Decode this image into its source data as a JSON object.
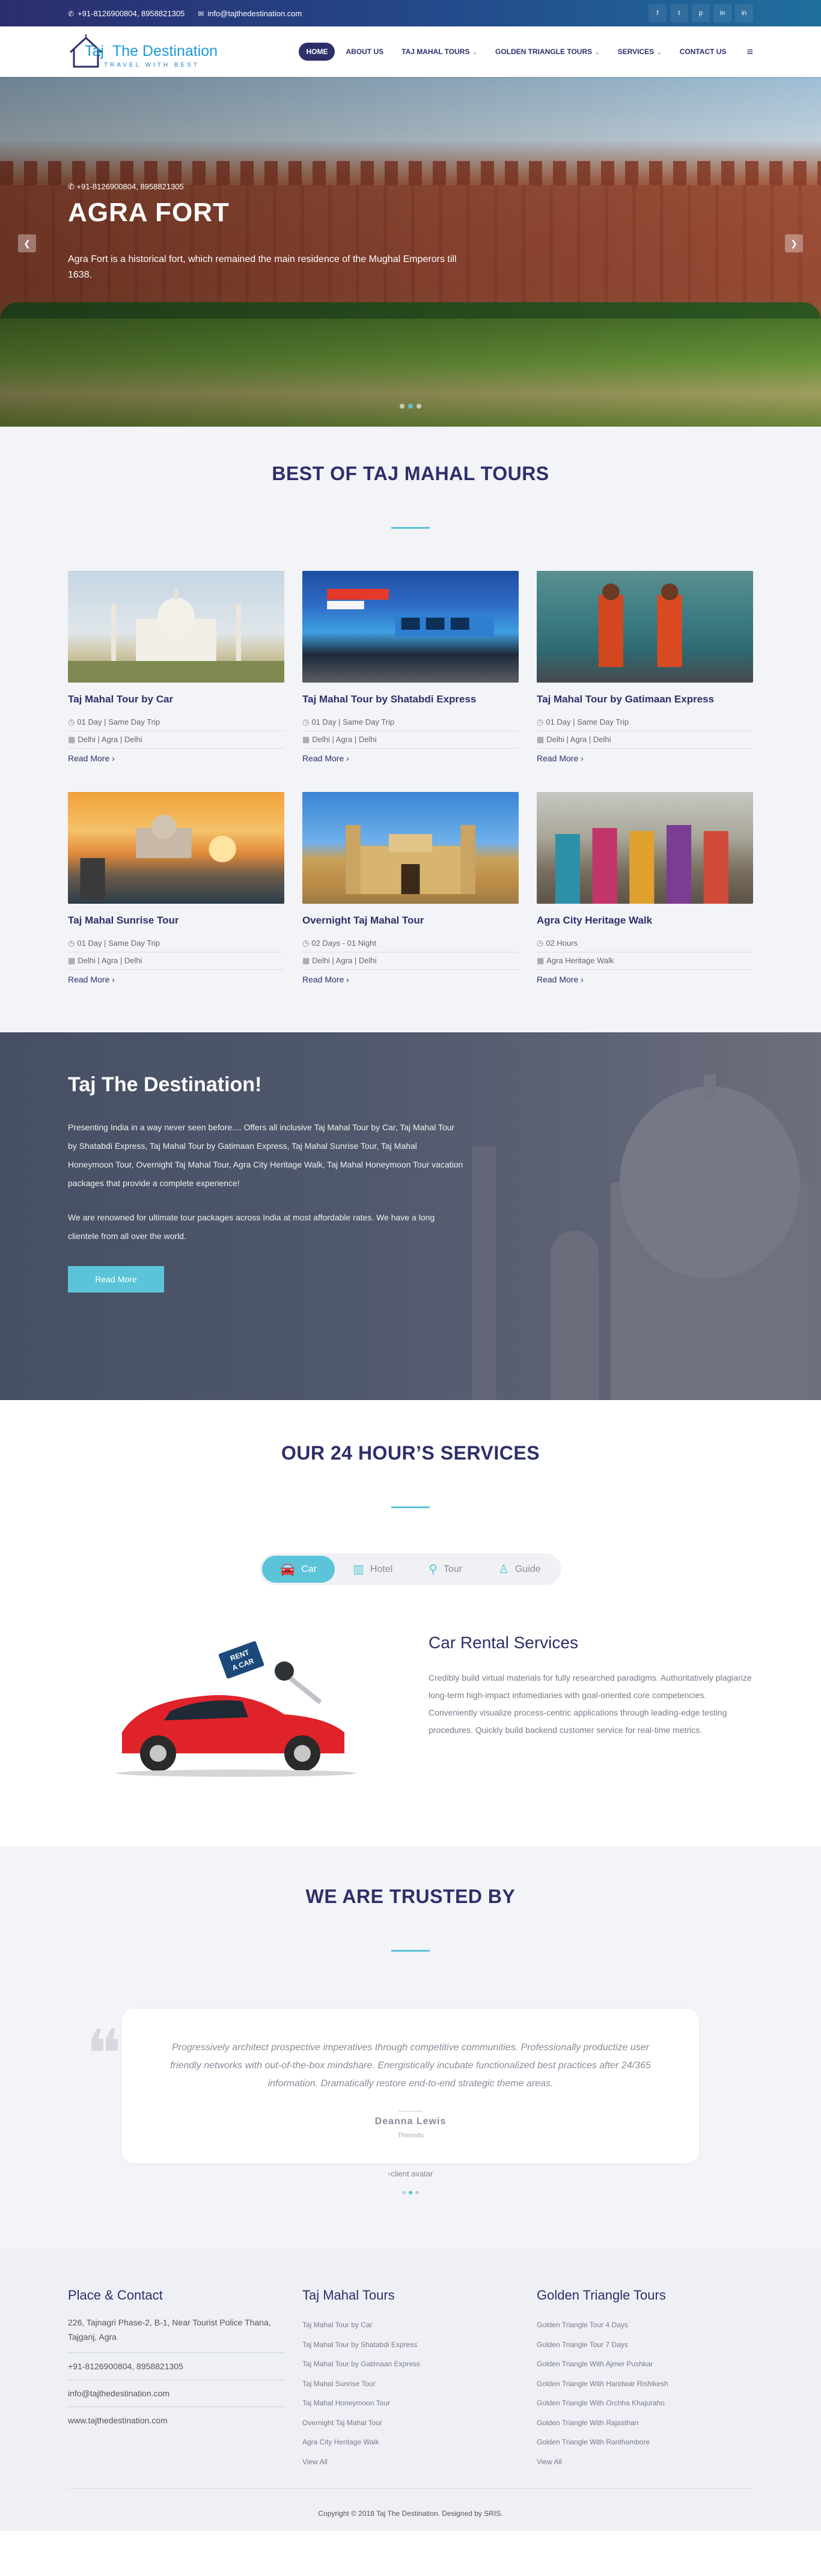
{
  "topbar": {
    "phone": "+91-8126900804, 8958821305",
    "email": "info@tajthedestination.com",
    "social": [
      "f",
      "t",
      "p",
      "in",
      "in"
    ]
  },
  "logo": {
    "part1": "Taj",
    "part2": "The Destination",
    "tagline": "TRAVEL WITH BEST"
  },
  "nav": {
    "items": [
      {
        "label": "HOME",
        "active": true
      },
      {
        "label": "ABOUT US"
      },
      {
        "label": "TAJ MAHAL TOURS",
        "caret": true
      },
      {
        "label": "GOLDEN TRIANGLE TOURS",
        "caret": true
      },
      {
        "label": "SERVICES",
        "caret": true
      },
      {
        "label": "CONTACT US"
      }
    ]
  },
  "hero": {
    "phone": "+91-8126900804, 8958821305",
    "title": "AGRA FORT",
    "description": "Agra Fort is a historical fort, which remained the main residence of the Mughal Emperors till 1638."
  },
  "tours": {
    "title": "BEST OF TAJ MAHAL TOURS",
    "items": [
      {
        "name": "Taj Mahal Tour by Car",
        "duration": "01 Day | Same Day Trip",
        "route": "Delhi | Agra | Delhi",
        "more": "Read More"
      },
      {
        "name": "Taj Mahal Tour by Shatabdi Express",
        "duration": "01 Day | Same Day Trip",
        "route": "Delhi | Agra | Delhi",
        "more": "Read More"
      },
      {
        "name": "Taj Mahal Tour by Gatimaan Express",
        "duration": "01 Day | Same Day Trip",
        "route": "Delhi | Agra | Delhi",
        "more": "Read More"
      },
      {
        "name": "Taj Mahal Sunrise Tour",
        "duration": "01 Day | Same Day Trip",
        "route": "Delhi | Agra | Delhi",
        "more": "Read More"
      },
      {
        "name": "Overnight Taj Mahal Tour",
        "duration": "02 Days - 01 Night",
        "route": "Delhi | Agra | Delhi",
        "more": "Read More"
      },
      {
        "name": "Agra City Heritage Walk",
        "duration": "02 Hours",
        "route": "Agra Heritage Walk",
        "more": "Read More"
      }
    ]
  },
  "about": {
    "title": "Taj The Destination!",
    "p1": "Presenting India in a way never seen before.... Offers all inclusive Taj Mahal Tour by Car, Taj Mahal Tour by Shatabdi Express, Taj Mahal Tour by Gatimaan Express, Taj Mahal Sunrise Tour, Taj Mahal Honeymoon Tour, Overnight Taj Mahal Tour, Agra City Heritage Walk, Taj Mahal Honeymoon Tour vacation packages that provide a complete experience!",
    "p2": "We are renowned for ultimate tour packages across India at most affordable rates. We have a long clientele from all over the world.",
    "button": "Read More"
  },
  "services": {
    "title": "OUR 24 HOUR’S SERVICES",
    "tabs": [
      {
        "label": "Car",
        "icon": "car-icon",
        "active": true
      },
      {
        "label": "Hotel",
        "icon": "hotel-icon"
      },
      {
        "label": "Tour",
        "icon": "location-pin-icon"
      },
      {
        "label": "Guide",
        "icon": "person-icon"
      }
    ],
    "heading": "Car Rental Services",
    "text": "Credibly build virtual materials for fully researched paradigms. Authoritatively plagiarize long-term high-impact infomediaries with goal-oriented core competencies. Conveniently visualize process-centric applications through leading-edge testing procedures. Quickly build backend customer service for real-time metrics.",
    "sign": "RENT\nA CAR"
  },
  "trusted": {
    "title": "WE ARE TRUSTED BY",
    "quote": "Progressively architect prospective imperatives through competitive communities. Professionally productize user friendly networks with out-of-the-box mindshare. Energistically incubate functionalized best practices after 24/365 information. Dramatically restore end-to-end strategic theme areas.",
    "name": "Deanna Lewis",
    "role": "Thenndu",
    "avatar_alt": "client avatar"
  },
  "footer": {
    "place": {
      "title": "Place & Contact",
      "address": "226, Tajnagri Phase-2, B-1, Near Tourist Police Thana, Tajganj, Agra",
      "phone": "+91-8126900804, 8958821305",
      "email": "info@tajthedestination.com",
      "website": "www.tajthedestination.com"
    },
    "taj": {
      "title": "Taj Mahal Tours",
      "links": [
        "Taj Mahal Tour by Car",
        "Taj Mahal Tour by Shatabdi Express",
        "Taj Mahal Tour by Gatimaan Express",
        "Taj Mahal Sunrise Tour",
        "Taj Mahal Honeymoon Tour",
        "Overnight Taj Mahal Tour",
        "Agra City Heritage Walk",
        "View All"
      ]
    },
    "golden": {
      "title": "Golden Triangle Tours",
      "links": [
        "Golden Triangle Tour 4 Days",
        "Golden Triangle Tour 7 Days",
        "Golden Triangle With Ajmer Pushkar",
        "Golden Triangle With Haridwar Rishikesh",
        "Golden Triangle With Orchha Khajuraho",
        "Golden Triangle With Rajasthan",
        "Golden Triangle With Ranthambore",
        "View All"
      ]
    },
    "copyright": "Copyright © 2018 Taj The Destination. Designed by SRIS."
  },
  "colors": {
    "primary": "#2d2f6a",
    "accent": "#5bc4d8",
    "brand": "#1b9ad6"
  }
}
